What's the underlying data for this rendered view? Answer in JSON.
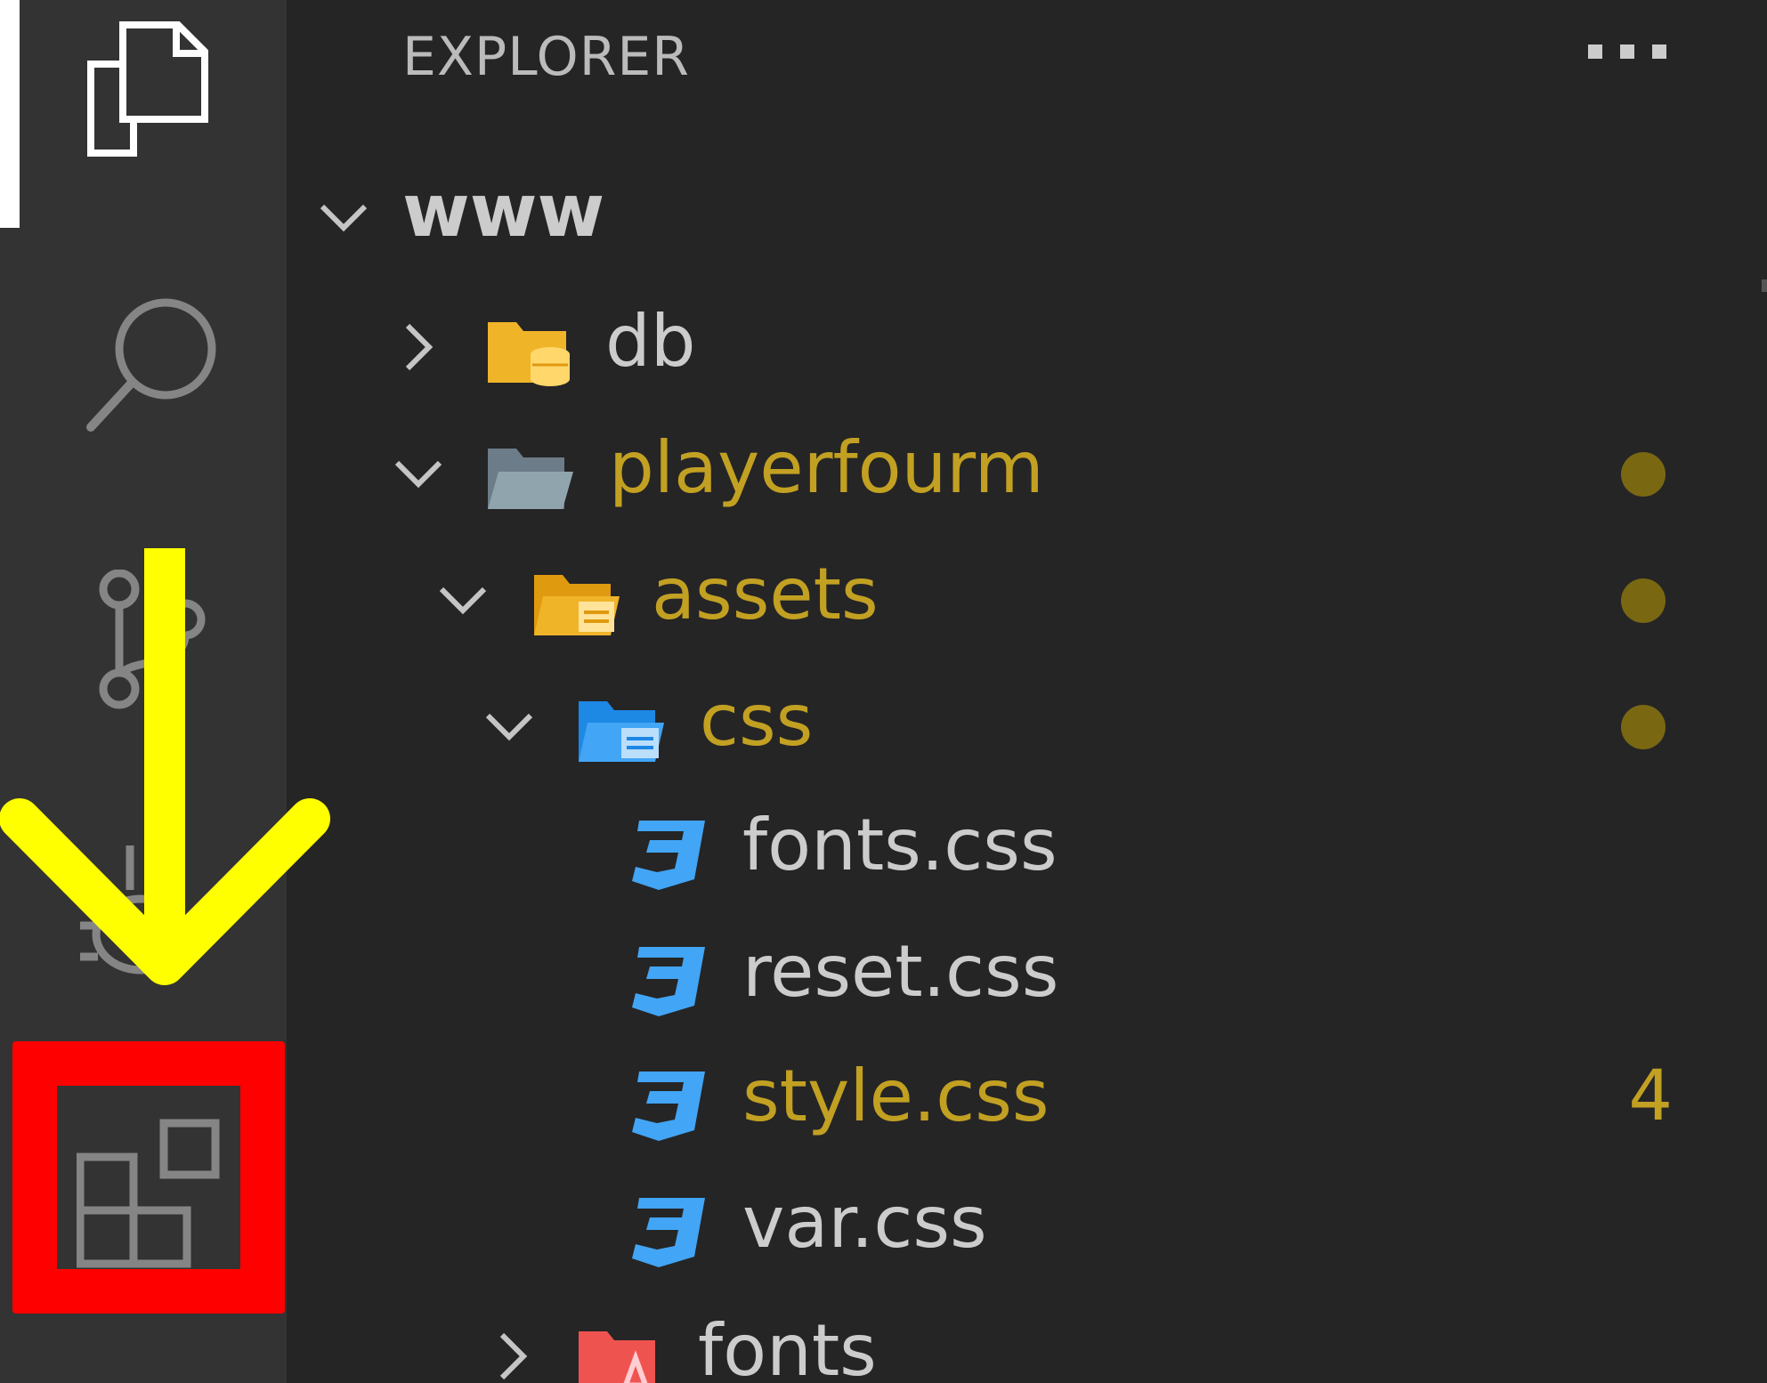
{
  "sidebar": {
    "title": "EXPLORER",
    "more_icon": "more-horizontal-icon"
  },
  "activity_bar": {
    "items": [
      {
        "name": "explorer",
        "icon": "files-icon",
        "active": true
      },
      {
        "name": "search",
        "icon": "search-icon"
      },
      {
        "name": "source-control",
        "icon": "source-control-icon"
      },
      {
        "name": "debug",
        "icon": "debug-icon"
      },
      {
        "name": "extensions",
        "icon": "extensions-icon",
        "highlighted": true
      }
    ]
  },
  "tree": {
    "root": {
      "label": "www",
      "expanded": true
    },
    "items": [
      {
        "label": "db",
        "type": "folder",
        "expanded": false,
        "icon": "database-folder-icon",
        "color": "#f0b429"
      },
      {
        "label": "playerfourm",
        "type": "folder",
        "expanded": true,
        "icon": "folder-open-icon",
        "color": "#8a9aa8",
        "modified": true
      },
      {
        "label": "assets",
        "type": "folder",
        "expanded": true,
        "icon": "assets-folder-icon",
        "color": "#f0b429",
        "modified": true
      },
      {
        "label": "css",
        "type": "folder",
        "expanded": true,
        "icon": "css-folder-icon",
        "color": "#42a5f5",
        "modified": true
      },
      {
        "label": "fonts.css",
        "type": "file",
        "icon": "css3-icon",
        "color": "#42a5f5"
      },
      {
        "label": "reset.css",
        "type": "file",
        "icon": "css3-icon",
        "color": "#42a5f5"
      },
      {
        "label": "style.css",
        "type": "file",
        "icon": "css3-icon",
        "color": "#42a5f5",
        "modified": true,
        "badge": "4"
      },
      {
        "label": "var.css",
        "type": "file",
        "icon": "css3-icon",
        "color": "#42a5f5"
      },
      {
        "label": "fonts",
        "type": "folder",
        "expanded": false,
        "icon": "fonts-folder-icon",
        "color": "#ef5350"
      }
    ]
  },
  "annotation": {
    "arrow_color": "#ffff00",
    "box_color": "#ff0000"
  }
}
